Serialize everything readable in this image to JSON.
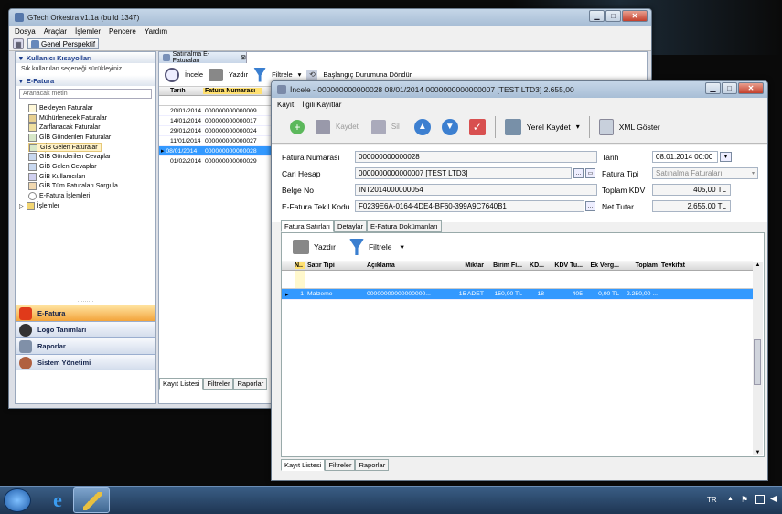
{
  "main_window": {
    "title": "GTech Orkestra v1.1a (build 1347)",
    "menu": [
      "Dosya",
      "Araçlar",
      "İşlemler",
      "Pencere",
      "Yardım"
    ],
    "perspective_button": "Genel Perspektif",
    "shortcuts_header": "Kullanıcı Kısayolları",
    "shortcuts_hint": "Sık kullanılan seçeneği sürükleyiniz",
    "efatura_header": "E-Fatura",
    "search_placeholder": "Aranacak metin",
    "tree": [
      "Bekleyen Faturalar",
      "Mühürlenecek Faturalar",
      "Zarflanacak Faturalar",
      "GİB Gönderilen Faturalar",
      "GİB Gelen Faturalar",
      "GİB Gönderilen Cevaplar",
      "GİB Gelen Cevaplar",
      "GİB Kullanıcıları",
      "GİB Tüm Faturaları Sorgula",
      "E-Fatura İşlemleri",
      "İşlemler"
    ],
    "nav": [
      "E-Fatura",
      "Logo Tanımları",
      "Raporlar",
      "Sistem Yönetimi"
    ],
    "list_tab_title": "Satınalma E-Faturaları",
    "list_toolbar": {
      "incele": "İncele",
      "yazdir": "Yazdır",
      "filtrele": "Filtrele",
      "reset": "Başlangıç Durumuna Döndür"
    },
    "list_columns": [
      "Tarih",
      "Fatura Numarası"
    ],
    "list_rows": [
      [
        "20/01/2014",
        "000000000000009"
      ],
      [
        "14/01/2014",
        "000000000000017"
      ],
      [
        "29/01/2014",
        "000000000000024"
      ],
      [
        "11/01/2014",
        "000000000000027"
      ],
      [
        "08/01/2014",
        "000000000000028"
      ],
      [
        "01/02/2014",
        "000000000000029"
      ]
    ],
    "bottom_tabs": [
      "Kayıt Listesi",
      "Filtreler",
      "Raporlar"
    ]
  },
  "detail_window": {
    "title": "İncele - 000000000000028 08/01/2014 0000000000000007 [TEST LTD3] 2.655,00",
    "menu": [
      "Kayıt",
      "İlgili Kayıtlar"
    ],
    "toolbar": {
      "kaydet": "Kaydet",
      "sil": "Sil",
      "yerel_kaydet": "Yerel Kaydet",
      "xml_goster": "XML Göster"
    },
    "labels": {
      "fatura_numarasi": "Fatura Numarası",
      "cari_hesap": "Cari Hesap",
      "belge_no": "Belge No",
      "tekil_kodu": "E-Fatura Tekil Kodu",
      "tarih": "Tarih",
      "fatura_tipi": "Fatura Tipi",
      "toplam_kdv": "Toplam KDV",
      "net_tutar": "Net Tutar"
    },
    "values": {
      "fatura_numarasi": "000000000000028",
      "cari_hesap": "0000000000000007 [TEST LTD3]",
      "belge_no": "INT2014000000054",
      "tekil_kodu": "F0239E6A-0164-4DE4-BF60-399A9C7640B1",
      "tarih": "08.01.2014 00:00",
      "fatura_tipi": "Satınalma Faturaları",
      "toplam_kdv": "405,00 TL",
      "net_tutar": "2.655,00 TL"
    },
    "tabs": [
      "Fatura Satırları",
      "Detaylar",
      "E-Fatura Dokümanları"
    ],
    "grid_toolbar": {
      "yazdir": "Yazdır",
      "filtrele": "Filtrele"
    },
    "grid_columns": [
      "N..",
      "Satır Tipi",
      "Açıklama",
      "Miktar",
      "Birim Fi...",
      "KD...",
      "KDV Tu...",
      "Ek Verg...",
      "Toplam",
      "Tevkifat"
    ],
    "grid_rows": [
      [
        "1",
        "Malzeme",
        "00000000000000000...",
        "15 ADET",
        "150,00 TL",
        "18",
        "405",
        "0,00 TL",
        "2.250,00 ...",
        ""
      ]
    ],
    "bottom_tabs": [
      "Kayıt Listesi",
      "Filtreler",
      "Raporlar"
    ]
  },
  "taskbar": {
    "lang": "TR",
    "clock": "..."
  },
  "colors": {
    "selection": "#3399ff",
    "nav_selected": "#f3a43b",
    "link_blue": "#1b3c8c"
  }
}
